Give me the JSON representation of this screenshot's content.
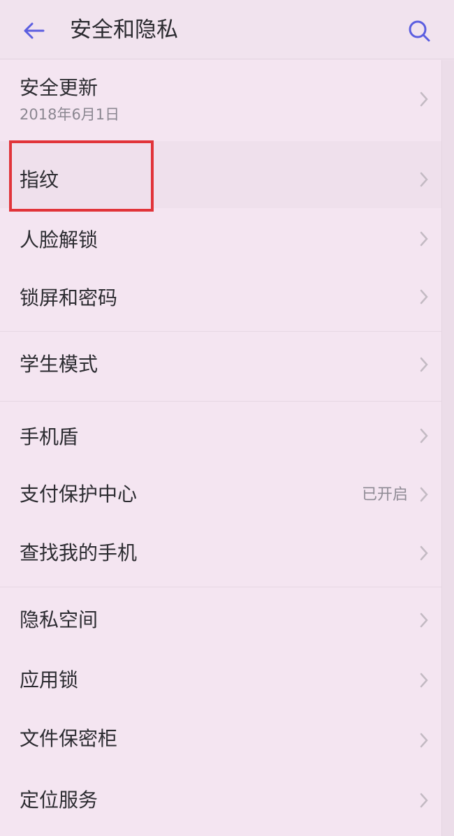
{
  "header": {
    "title": "安全和隐私",
    "back_icon": "back-arrow-icon",
    "search_icon": "search-icon",
    "accent": "#5b5ee0"
  },
  "items": [
    {
      "label": "安全更新",
      "sub": "2018年6月1日"
    },
    {
      "label": "指纹"
    },
    {
      "label": "人脸解锁"
    },
    {
      "label": "锁屏和密码"
    },
    {
      "label": "学生模式"
    },
    {
      "label": "手机盾"
    },
    {
      "label": "支付保护中心",
      "value": "已开启"
    },
    {
      "label": "查找我的手机"
    },
    {
      "label": "隐私空间"
    },
    {
      "label": "应用锁"
    },
    {
      "label": "文件保密柜"
    },
    {
      "label": "定位服务"
    }
  ],
  "highlight_color": "#e1343a"
}
